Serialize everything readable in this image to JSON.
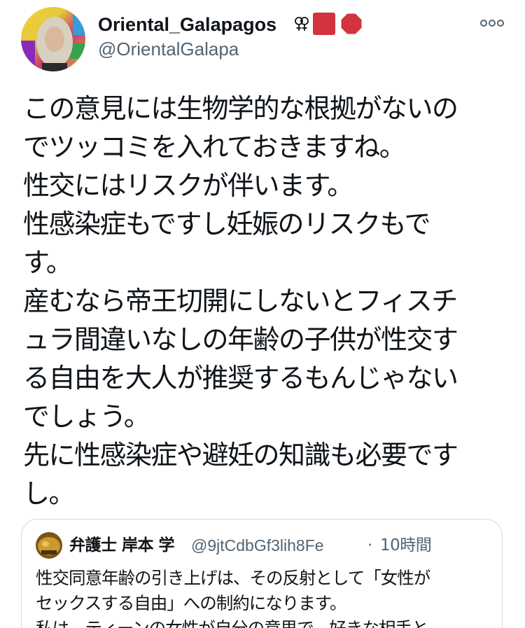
{
  "author": {
    "display_name": "Oriental_Galapagos",
    "handle": "@OrientalGalapa",
    "badge_icons": [
      "double-venus-icon",
      "red-square-icon",
      "red-octagon-icon"
    ]
  },
  "tweet": {
    "lines": [
      "この意見には生物学的な根拠がないの",
      "でツッコミを入れておきますね。",
      "性交にはリスクが伴います。",
      "性感染症もですし妊娠のリスクもで",
      "す。",
      "産むなら帝王切開にしないとフィスチ",
      "ュラ間違いなしの年齢の子供が性交す",
      "る自由を大人が推奨するもんじゃない",
      "でしょう。",
      "先に性感染症や避妊の知識も必要です",
      "し。"
    ]
  },
  "quoted": {
    "display_name": "弁護士 岸本 学",
    "handle": "@9jtCdbGf3lih8Fe",
    "separator": "·",
    "time": "10時間",
    "lines": [
      "性交同意年齢の引き上げは、その反射として「女性が",
      "セックスする自由」への制約になります。",
      "私は、ティーンの女性が自分の意思で、好きな相手と"
    ]
  },
  "colors": {
    "text": "#0f1419",
    "secondary": "#536471",
    "border": "#cfd9de",
    "badge_red": "#d1343e"
  }
}
